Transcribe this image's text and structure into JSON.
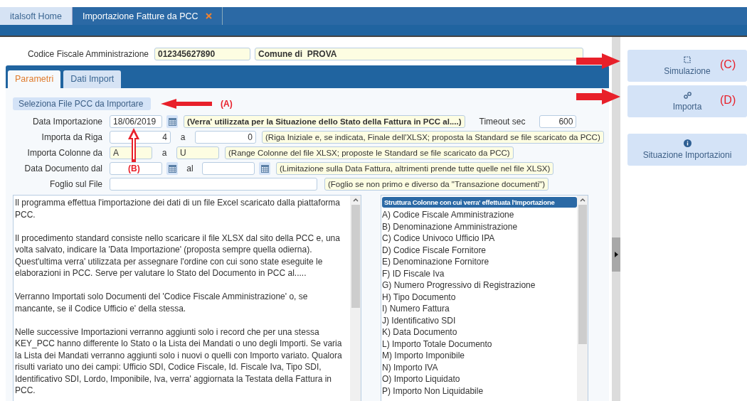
{
  "tabs": [
    {
      "label": "italsoft Home",
      "selected": false,
      "closable": false
    },
    {
      "label": "Importazione Fatture da PCC",
      "selected": true,
      "closable": true
    }
  ],
  "header": {
    "label": "Codice Fiscale Amministrazione",
    "code": "012345627890",
    "name": "Comune di  PROVA"
  },
  "form_tabs": [
    {
      "label": "Parametri",
      "selected": true
    },
    {
      "label": "Dati Import",
      "selected": false
    }
  ],
  "select_file": {
    "label": "Seleziona File PCC da Importare",
    "annotation": "(A)"
  },
  "rows": [
    {
      "label": "Data Importazione",
      "fields": [
        {
          "kind": "date",
          "value": "18/06/2019",
          "annotation": "(B)"
        }
      ],
      "note": "(Verra' utilizzata per la Situazione dello Stato della Fattura in PCC al....)",
      "note_bold": true,
      "timeout": {
        "label": "Timeout sec",
        "value": "600"
      }
    },
    {
      "label": "Importa da Riga",
      "fields": [
        {
          "kind": "number",
          "value": "4"
        },
        {
          "kind": "number",
          "prefix": "a",
          "value": "0"
        }
      ],
      "note": "(Riga Iniziale e, se indicata, Finale dell'XLSX; proposta la Standard se file scaricato da PCC)",
      "note_bold": false
    },
    {
      "label": "Importa Colonne da",
      "fields": [
        {
          "kind": "code",
          "value": "A"
        },
        {
          "kind": "code",
          "prefix": "a",
          "value": "U"
        }
      ],
      "note": "(Range Colonne del file XLSX; proposte le Standard se file scaricato da PCC)",
      "note_bold": false
    },
    {
      "label": "Data Documento dal",
      "fields": [
        {
          "kind": "date"
        },
        {
          "kind": "date",
          "prefix": "al"
        }
      ],
      "note": "(Limitazione sulla Data Fattura, altrimenti prende tutte quelle nel file XLSX)",
      "note_bold": false
    },
    {
      "label": "Foglio sul File",
      "fields": [
        {
          "kind": "wide"
        }
      ],
      "note": "(Foglio se non primo e diverso da \"Transazione documenti\")",
      "note_bold": false
    }
  ],
  "description": [
    "Il programma effettua l'importazione dei dati di un file Excel scaricato dalla piattaforma PCC.",
    "Il procedimento standard consiste nello scaricare il file XLSX dal sito della PCC e, una volta salvato, indicare la 'Data Importazione' (proposta sempre quella odierna). Quest'ultima verra' utilizzata per assegnare l'ordine con cui sono state eseguite le elaborazioni in PCC. Serve per valutare lo Stato del Documento in PCC al.....",
    "Verranno Importati solo Documenti del 'Codice Fiscale Amministrazione' o, se mancante, se il Codice Ufficio e' della stessa.",
    "Nelle successive Importazioni verranno aggiunti solo i record che per una stessa KEY_PCC hanno differente lo Stato o la Lista dei Mandati o uno degli Importi. Se varia la Lista dei Mandati verranno aggiunti solo i nuovi o quelli con Importo variato. Qualora risulti variato uno dei campi: Ufficio SDI, Codice Fiscale, Id. Fiscale Iva, Tipo SDI, Identificativo SDI, Lordo, Imponibile, Iva, verra' aggiornata la Testata della Fattura in PCC."
  ],
  "columns_list": {
    "title": "Struttura Colonne con cui verra' effettuata l'Importazione",
    "items": [
      "A) Codice Fiscale Amministrazione",
      "B) Denominazione Amministrazione",
      "C) Codice Univoco Ufficio IPA",
      "D) Codice Fiscale Fornitore",
      "E) Denominazione Fornitore",
      "F) ID Fiscale Iva",
      "G) Numero Progressivo di Registrazione",
      "H) Tipo Documento",
      "I) Numero Fattura",
      "J) Identificativo SDI",
      "K) Data Documento",
      "L) Importo Totale Documento",
      "M) Importo Imponibile",
      "N) Importo IVA",
      "O) Importo Liquidato",
      "P) Importo Non Liquidabile"
    ]
  },
  "side_buttons": [
    {
      "label": "Simulazione",
      "annotation": "(C)"
    },
    {
      "label": "Importa",
      "annotation": "(D)"
    },
    {
      "label": "Situazione Importazioni"
    }
  ]
}
